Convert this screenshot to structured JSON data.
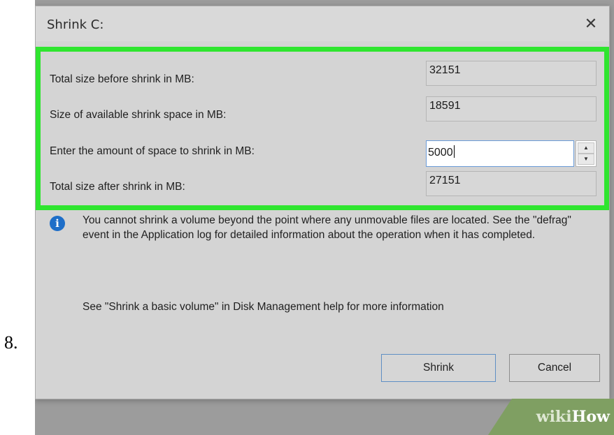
{
  "step": {
    "number": "8."
  },
  "dialog": {
    "title": "Shrink C:",
    "close_glyph": "✕",
    "rows": [
      {
        "label": "Total size before shrink in MB:",
        "value": "32151"
      },
      {
        "label": "Size of available shrink space in MB:",
        "value": "18591"
      },
      {
        "label": "Enter the amount of space to shrink in MB:",
        "value": "5000"
      },
      {
        "label": "Total size after shrink in MB:",
        "value": "27151"
      }
    ],
    "spinner": {
      "up": "▲",
      "down": "▼"
    },
    "info_icon_glyph": "i",
    "info_text": "You cannot shrink a volume beyond the point where any unmovable files are located. See the \"defrag\" event in the Application log for detailed information about the operation when it has completed.",
    "help_text": "See \"Shrink a basic volume\" in Disk Management help for more information",
    "buttons": {
      "shrink": "Shrink",
      "cancel": "Cancel"
    }
  },
  "watermark": {
    "wiki": "wiki",
    "how": "How"
  },
  "colors": {
    "highlight": "#2fe52f",
    "info_icon": "#1e6ec8",
    "watermark_bg": "#7f9f62"
  },
  "icons": {
    "close": "close-icon",
    "info": "info-icon",
    "spin_up": "spin-up-icon",
    "spin_down": "spin-down-icon"
  }
}
